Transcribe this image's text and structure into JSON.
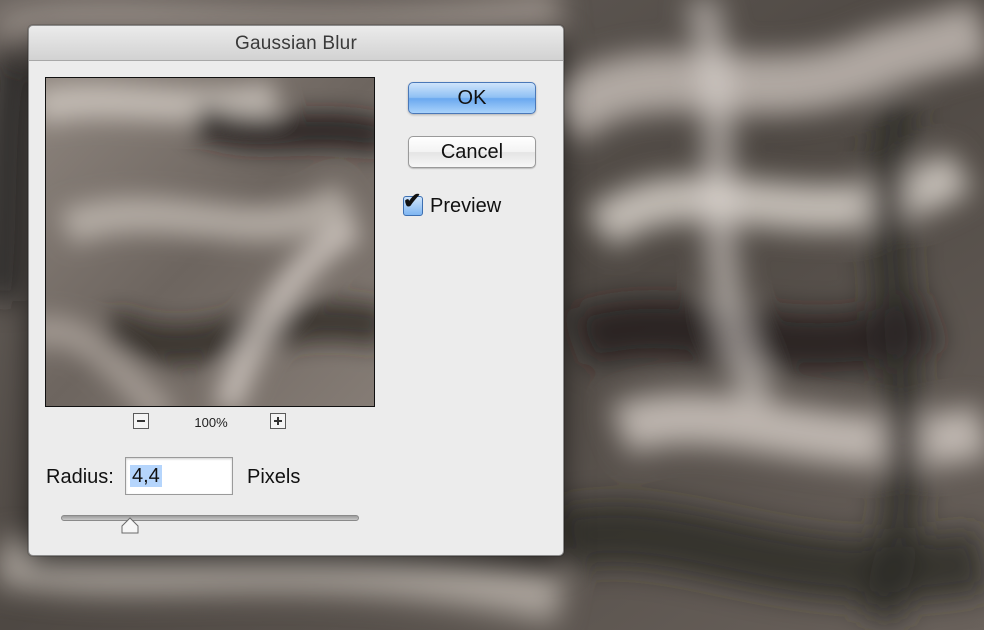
{
  "dialog": {
    "title": "Gaussian Blur",
    "ok_label": "OK",
    "cancel_label": "Cancel",
    "preview_label": "Preview",
    "preview_checked": true,
    "zoom_level": "100%",
    "zoom_out_icon": "minus-icon",
    "zoom_in_icon": "plus-icon",
    "radius_label": "Radius:",
    "radius_value": "4,4",
    "unit_label": "Pixels",
    "slider_fraction": 0.23
  },
  "colors": {
    "dialog_bg": "#ececec",
    "ok_button": "#8fc0f4",
    "selection_highlight": "#b5d5fc"
  }
}
